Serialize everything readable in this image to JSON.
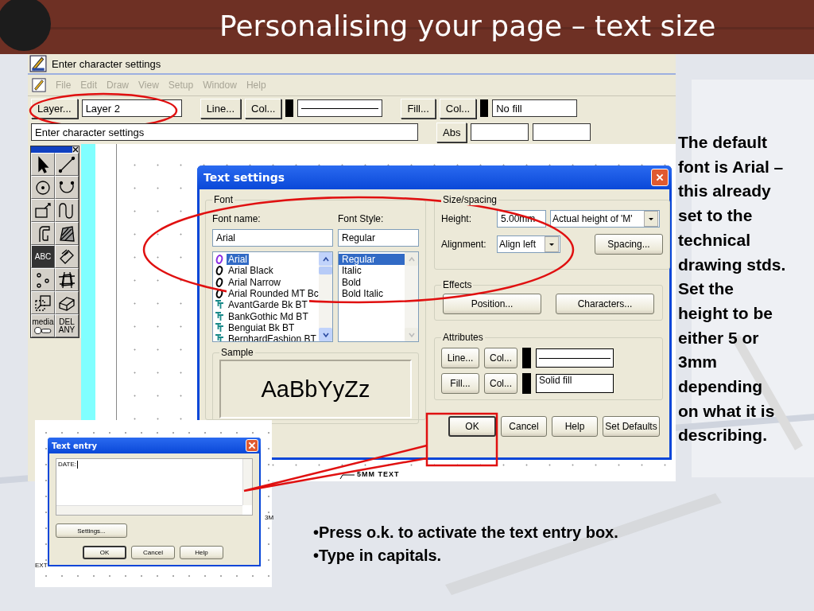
{
  "slide": {
    "title": "Personalising your page – text size",
    "side_note": "The default\nfont is Arial –\nthis already\nset to the\ntechnical\ndrawing stds.\nSet the\nheight to be\neither 5 or\n3mm\ndepending\non what it is\ndescribing.",
    "bullets": [
      "•Press o.k. to activate the text entry box.",
      "•Type in capitals."
    ]
  },
  "app": {
    "title": "Enter character settings",
    "menu": [
      {
        "label": "File",
        "disabled": true
      },
      {
        "label": "Edit",
        "disabled": true
      },
      {
        "label": "Draw",
        "disabled": true
      },
      {
        "label": "View",
        "disabled": true
      },
      {
        "label": "Setup",
        "disabled": true
      },
      {
        "label": "Window",
        "disabled": true
      },
      {
        "label": "Help",
        "disabled": true
      }
    ],
    "toolbar": {
      "layer_button": "Layer...",
      "layer": "Layer 2",
      "line_button": "Line...",
      "line_color_button": "Col...",
      "fill_button": "Fill...",
      "fill_color_button": "Col...",
      "fill": "No fill",
      "prompt": "Enter character settings",
      "abs_button": "Abs"
    },
    "tools": [
      {
        "kind": "pointer",
        "selected": false
      },
      {
        "kind": "line",
        "selected": false
      },
      {
        "kind": "circle",
        "selected": false
      },
      {
        "kind": "arc",
        "selected": false
      },
      {
        "kind": "rectangle",
        "selected": false
      },
      {
        "kind": "curve",
        "selected": false
      },
      {
        "kind": "hook",
        "selected": false
      },
      {
        "kind": "hatch",
        "selected": false
      },
      {
        "kind": "text",
        "label": "ABC",
        "selected": true
      },
      {
        "kind": "dimension",
        "selected": false
      },
      {
        "kind": "points",
        "selected": false
      },
      {
        "kind": "trim",
        "selected": false
      },
      {
        "kind": "move",
        "selected": false
      },
      {
        "kind": "block",
        "selected": false
      },
      {
        "kind": "media",
        "label": "media",
        "selected": false
      },
      {
        "kind": "delete",
        "label": "DEL ANY",
        "selected": false
      }
    ],
    "canvas_label": "5MM TEXT"
  },
  "text_settings": {
    "title": "Text settings",
    "font_group": "Font",
    "font_name_label": "Font name:",
    "font_style_label": "Font Style:",
    "font_name": "Arial",
    "font_style": "Regular",
    "fonts": [
      {
        "name": "Arial",
        "kind": "opentype",
        "selected": true
      },
      {
        "name": "Arial Black",
        "kind": "opentype",
        "selected": false
      },
      {
        "name": "Arial Narrow",
        "kind": "opentype",
        "selected": false
      },
      {
        "name": "Arial Rounded MT Bc",
        "kind": "opentype",
        "selected": false
      },
      {
        "name": "AvantGarde Bk BT",
        "kind": "truetype",
        "selected": false
      },
      {
        "name": "BankGothic Md BT",
        "kind": "truetype",
        "selected": false
      },
      {
        "name": "Benguiat Bk BT",
        "kind": "truetype",
        "selected": false
      },
      {
        "name": "BernhardFashion BT",
        "kind": "truetype",
        "selected": false
      }
    ],
    "styles": [
      {
        "name": "Regular",
        "selected": true
      },
      {
        "name": "Italic",
        "selected": false
      },
      {
        "name": "Bold",
        "selected": false
      },
      {
        "name": "Bold Italic",
        "selected": false
      }
    ],
    "sample_group": "Sample",
    "sample": "AaBbYyZz",
    "size_group": "Size/spacing",
    "height_label": "Height:",
    "height": "5.00mm",
    "height_mode": "Actual height of 'M'",
    "alignment_label": "Alignment:",
    "alignment": "Align left",
    "spacing_button": "Spacing...",
    "effects_group": "Effects",
    "position_button": "Position...",
    "characters_button": "Characters...",
    "attributes_group": "Attributes",
    "line_button": "Line...",
    "line_color_button": "Col...",
    "fill_button": "Fill...",
    "fill_color_button": "Col...",
    "fill": "Solid fill",
    "buttons": [
      {
        "label": "OK",
        "default": true
      },
      {
        "label": "Cancel",
        "default": false
      },
      {
        "label": "Help",
        "default": false
      },
      {
        "label": "Set Defaults",
        "default": false
      }
    ]
  },
  "text_entry": {
    "title": "Text entry",
    "text": "DATE:",
    "settings_button": "Settings...",
    "buttons": [
      {
        "label": "OK",
        "default": true
      },
      {
        "label": "Cancel",
        "default": false
      },
      {
        "label": "Help",
        "default": false
      }
    ],
    "canvas_labels": [
      "3M",
      "EXT"
    ]
  }
}
